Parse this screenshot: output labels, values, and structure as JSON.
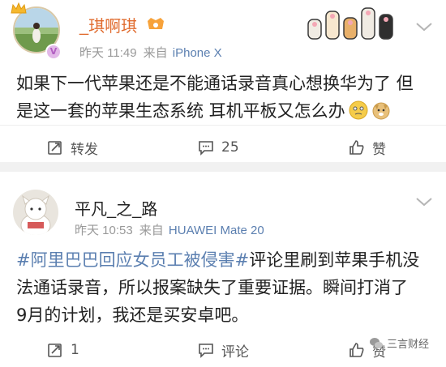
{
  "posts": [
    {
      "username": "_琪啊琪",
      "time": "昨天 11:49",
      "source_prefix": "来自",
      "source": "iPhone X",
      "content_line1": "如果下一代苹果还是不能通话录音真心想换华为了 但",
      "content_line2": "是这一套的苹果生态系统 耳机平板又怎么办",
      "actions": {
        "repost": "转发",
        "comment": "25",
        "like": "赞"
      }
    },
    {
      "username": "平凡_之_路",
      "time": "昨天 10:53",
      "source_prefix": "来自",
      "source": "HUAWEI Mate 20",
      "topic": "#阿里巴巴回应女员工被侵害#",
      "content_after_topic": "评论里刷到苹果手机没",
      "content_line2": "法通话录音，所以报案缺失了重要证据。瞬间打消了",
      "content_line3": "9月的计划，我还是买安卓吧。",
      "actions": {
        "repost": "1",
        "comment": "评论",
        "like": "赞"
      }
    }
  ],
  "watermark": "三言财经",
  "colors": {
    "vip_name": "#e06b2e",
    "link": "#5b7fb0",
    "meta": "#999999"
  }
}
